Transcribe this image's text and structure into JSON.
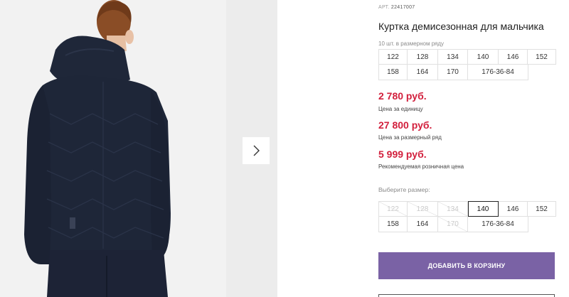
{
  "product": {
    "art_label": "АРТ.",
    "art_value": "22417007",
    "title": "Куртка демисезонная для мальчика",
    "size_row_note": "10 шт. в размерном ряду"
  },
  "size_row": {
    "row1": [
      "122",
      "128",
      "134",
      "140",
      "146",
      "152"
    ],
    "row2": [
      "158",
      "164",
      "170",
      "176-36-84"
    ]
  },
  "prices": {
    "unit_price": "2 780 руб.",
    "unit_label": "Цена за единицу",
    "row_price": "27 800 руб.",
    "row_label": "Цена за размерный ряд",
    "retail_price": "5 999 руб.",
    "retail_label": "Рекомендуемая розничная цена"
  },
  "size_picker": {
    "label": "Выберите размер:",
    "row1": [
      {
        "value": "122",
        "available": false
      },
      {
        "value": "128",
        "available": false
      },
      {
        "value": "134",
        "available": false
      },
      {
        "value": "140",
        "available": true,
        "selected": true
      },
      {
        "value": "146",
        "available": true
      },
      {
        "value": "152",
        "available": true
      }
    ],
    "row2": [
      {
        "value": "158",
        "available": true
      },
      {
        "value": "164",
        "available": true
      },
      {
        "value": "170",
        "available": false
      },
      {
        "value": "176-36-84",
        "available": true
      }
    ]
  },
  "cart_button_label": "ДОБАВИТЬ В КОРЗИНУ",
  "icons": {
    "next": "chevron-right-icon"
  },
  "colors": {
    "price": "#d21f3c",
    "button": "#7a62a5",
    "jacket": "#1e2638"
  }
}
